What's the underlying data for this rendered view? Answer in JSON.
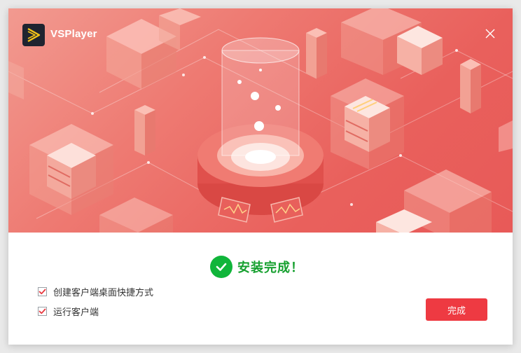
{
  "app": {
    "title": "VSPlayer",
    "icon": "play-logo-icon"
  },
  "window": {
    "close_icon": "close-icon"
  },
  "banner": {
    "illustration": "isometric-server-install-illustration"
  },
  "status": {
    "icon": "check-circle-icon",
    "text": "安装完成！",
    "color": "#16a02f"
  },
  "options": [
    {
      "label": "创建客户端桌面快捷方式",
      "checked": true
    },
    {
      "label": "运行客户端",
      "checked": true
    }
  ],
  "finish_button": {
    "label": "完成",
    "color": "#ee3a42"
  },
  "colors": {
    "banner_start": "#f29a90",
    "banner_end": "#e85a58",
    "check_green": "#10b53a"
  }
}
